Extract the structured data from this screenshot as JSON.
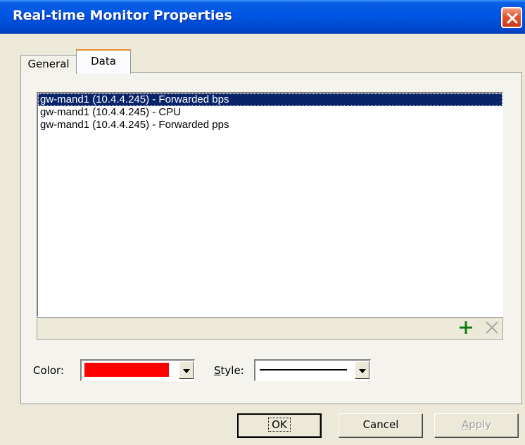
{
  "window": {
    "title": "Real-time Monitor Properties",
    "close_icon": "close-icon",
    "title_color": "#0055E5",
    "close_color": "#E3532D"
  },
  "tabs": [
    {
      "label": "General",
      "active": false
    },
    {
      "label": "Data",
      "active": true
    }
  ],
  "data_list": {
    "items": [
      {
        "label": "gw-mand1 (10.4.4.245) - Forwarded bps",
        "selected": true
      },
      {
        "label": "gw-mand1 (10.4.4.245) - CPU",
        "selected": false
      },
      {
        "label": "gw-mand1 (10.4.4.245) - Forwarded pps",
        "selected": false
      }
    ],
    "add_icon": "plus-icon",
    "remove_icon": "x-icon"
  },
  "color_field": {
    "label": "Color:",
    "value": "#FF0000"
  },
  "style_field": {
    "label_prefix": "",
    "label_accel": "S",
    "label_rest": "tyle:",
    "value": "solid-line"
  },
  "buttons": {
    "ok": "OK",
    "cancel": "Cancel",
    "apply_accel": "A",
    "apply_rest": "pply"
  }
}
